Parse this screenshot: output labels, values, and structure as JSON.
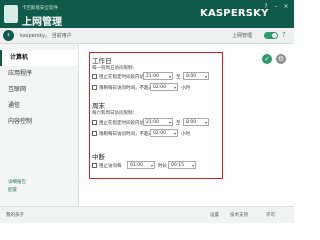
{
  "header": {
    "app_small_title": "卡巴斯基安全软件",
    "app_title": "上网管理",
    "brand": "KASPERSKY",
    "window_buttons": [
      "?",
      "–",
      "×"
    ]
  },
  "subheader": {
    "user": "kaspersky。 当前用户",
    "parental_control_label": "上网管理",
    "parental_enabled": true
  },
  "sidebar": {
    "items": [
      {
        "label": "计算机",
        "active": true
      },
      {
        "label": "应用程序",
        "active": false
      },
      {
        "label": "互联网",
        "active": false
      },
      {
        "label": "通信",
        "active": false
      },
      {
        "label": "内容控制",
        "active": false
      }
    ],
    "links": [
      "详细报告",
      "配置"
    ]
  },
  "workday": {
    "title": "工作日",
    "caption": "每一到周五访问限制：",
    "row1_label": "阻止在指定时间段内访问",
    "row1_from": "21:00",
    "row1_to_label": "至",
    "row1_to": "8:00",
    "row2_label": "限制每日访问时间，不超过",
    "row2_value": "02:00",
    "row2_unit": "小时"
  },
  "weekend": {
    "title": "周末",
    "caption": "每六和周日访问限制：",
    "row1_label": "阻止在指定时间段内访问",
    "row1_from": "21:00",
    "row1_to_label": "至",
    "row1_to": "8:00",
    "row2_label": "限制每日访问时间，不超过",
    "row2_value": "02:00",
    "row2_unit": "小时"
  },
  "breaks": {
    "title": "中断",
    "row_label": "阻止访问每",
    "row_value": "01:00",
    "mid_label": "时长",
    "row_value2": "00:15"
  },
  "footer": {
    "left": "我的孩子",
    "right1": "设置",
    "right2": "技术支持",
    "right3": "许可"
  }
}
